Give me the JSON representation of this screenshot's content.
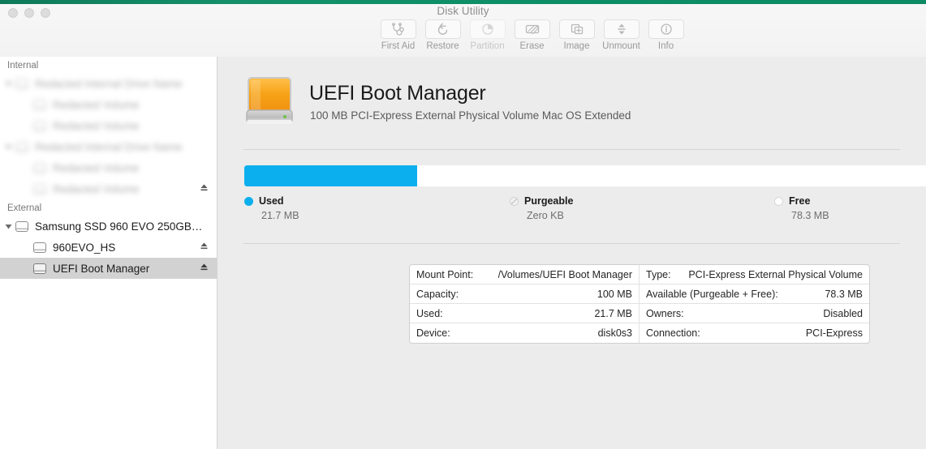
{
  "window": {
    "title": "Disk Utility",
    "traffic_lights": [
      "close-button",
      "minimize-button",
      "zoom-button"
    ]
  },
  "toolbar": {
    "items": [
      {
        "label": "First Aid",
        "icon": "stethoscope-icon",
        "enabled": true
      },
      {
        "label": "Restore",
        "icon": "restore-arrow-icon",
        "enabled": true
      },
      {
        "label": "Partition",
        "icon": "pie-chart-icon",
        "enabled": false
      },
      {
        "label": "Erase",
        "icon": "erase-disk-icon",
        "enabled": true
      },
      {
        "label": "Image",
        "icon": "disk-image-icon",
        "enabled": true
      },
      {
        "label": "Unmount",
        "icon": "unmount-arrows-icon",
        "enabled": true
      },
      {
        "label": "Info",
        "icon": "info-circle-icon",
        "enabled": true
      }
    ]
  },
  "sidebar": {
    "groups": [
      {
        "header": "Internal",
        "items": [
          {
            "label": "Redacted Internal Drive Name",
            "level": 0,
            "expanded": true,
            "blurred": true,
            "eject": false,
            "selected": false
          },
          {
            "label": "Redacted Volume",
            "level": 1,
            "blurred": true,
            "eject": false,
            "selected": false
          },
          {
            "label": "Redacted Volume",
            "level": 1,
            "blurred": true,
            "eject": false,
            "selected": false
          },
          {
            "label": "Redacted Internal Drive Name",
            "level": 0,
            "expanded": true,
            "blurred": true,
            "eject": false,
            "selected": false
          },
          {
            "label": "Redacted Volume",
            "level": 1,
            "blurred": true,
            "eject": false,
            "selected": false
          },
          {
            "label": "Redacted Volume",
            "level": 1,
            "blurred": true,
            "eject": true,
            "selected": false
          }
        ]
      },
      {
        "header": "External",
        "items": [
          {
            "label": "Samsung SSD 960 EVO 250GB…",
            "level": 0,
            "expanded": true,
            "blurred": false,
            "eject": false,
            "selected": false
          },
          {
            "label": "960EVO_HS",
            "level": 1,
            "blurred": false,
            "eject": true,
            "selected": false
          },
          {
            "label": "UEFI Boot Manager",
            "level": 1,
            "blurred": false,
            "eject": true,
            "selected": true
          }
        ]
      }
    ]
  },
  "volume": {
    "icon": "external-hard-drive-icon",
    "name": "UEFI Boot Manager",
    "subtitle": "100 MB PCI-Express External Physical Volume Mac OS Extended"
  },
  "usage": {
    "bar_used_percent": 25.3,
    "used_color": "#0CAFEE",
    "free_color": "#FFFFFF",
    "legend": [
      {
        "name": "Used",
        "value": "21.7 MB",
        "swatch": "filled-dot"
      },
      {
        "name": "Purgeable",
        "value": "Zero KB",
        "swatch": "slashed-dot"
      },
      {
        "name": "Free",
        "value": "78.3 MB",
        "swatch": "empty-dot"
      }
    ]
  },
  "info": {
    "left": [
      {
        "key": "Mount Point:",
        "value": "/Volumes/UEFI Boot Manager"
      },
      {
        "key": "Capacity:",
        "value": "100 MB"
      },
      {
        "key": "Used:",
        "value": "21.7 MB"
      },
      {
        "key": "Device:",
        "value": "disk0s3"
      }
    ],
    "right": [
      {
        "key": "Type:",
        "value": "PCI-Express External Physical Volume"
      },
      {
        "key": "Available (Purgeable + Free):",
        "value": "78.3 MB"
      },
      {
        "key": "Owners:",
        "value": "Disabled"
      },
      {
        "key": "Connection:",
        "value": "PCI-Express"
      }
    ]
  }
}
